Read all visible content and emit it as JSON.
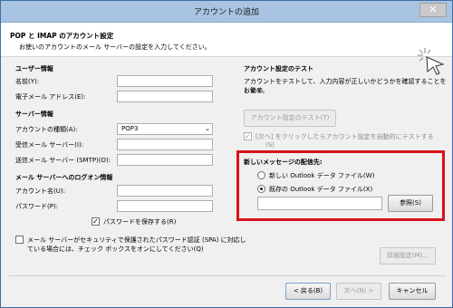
{
  "window": {
    "title": "アカウントの追加",
    "close": "✕"
  },
  "header": {
    "title": "POP と IMAP のアカウント設定",
    "subtitle": "お使いのアカウントのメール サーバーの設定を入力してください。"
  },
  "user_info": {
    "heading": "ユーザー情報",
    "name_label": "名前(Y):",
    "name_value": "",
    "email_label": "電子メール アドレス(E):",
    "email_value": ""
  },
  "server_info": {
    "heading": "サーバー情報",
    "account_type_label": "アカウントの種類(A):",
    "account_type_value": "POP3",
    "incoming_label": "受信メール サーバー(I):",
    "incoming_value": "",
    "outgoing_label": "送信メール サーバー (SMTP)(O):",
    "outgoing_value": ""
  },
  "logon_info": {
    "heading": "メール サーバーへのログオン情報",
    "account_name_label": "アカウント名(U):",
    "account_name_value": "",
    "password_label": "パスワード(P):",
    "password_value": "",
    "save_password_label": "パスワードを保存する(R)",
    "save_password_checked": true,
    "spa_label_line1": "メール サーバーがセキュリティで保護されたパスワード認証 (SPA) に対応し",
    "spa_label_line2": "ている場合には、チェック ボックスをオンにしてください(Q)",
    "spa_checked": false
  },
  "account_test": {
    "heading": "アカウント設定のテスト",
    "description_line1": "アカウントをテストして、入力内容が正しいかどうかを確認することをお勧め",
    "description_line2": "します。",
    "test_button": "アカウント設定のテスト(T)",
    "auto_test_line1": "[次へ] をクリックしたらアカウント設定を自動的にテストする",
    "auto_test_line2": "(S)",
    "auto_test_checked": true
  },
  "delivery": {
    "heading": "新しいメッセージの配信先:",
    "new_file_label": "新しい Outlook データ ファイル(W)",
    "existing_file_label": "既存の Outlook データ ファイル(X)",
    "selected": "existing",
    "path_value": "",
    "browse_button": "参照(S)"
  },
  "details_button": "詳細設定(M)...",
  "footer": {
    "back": "< 戻る(B)",
    "next": "次へ(N) >",
    "cancel": "キャンセル"
  }
}
